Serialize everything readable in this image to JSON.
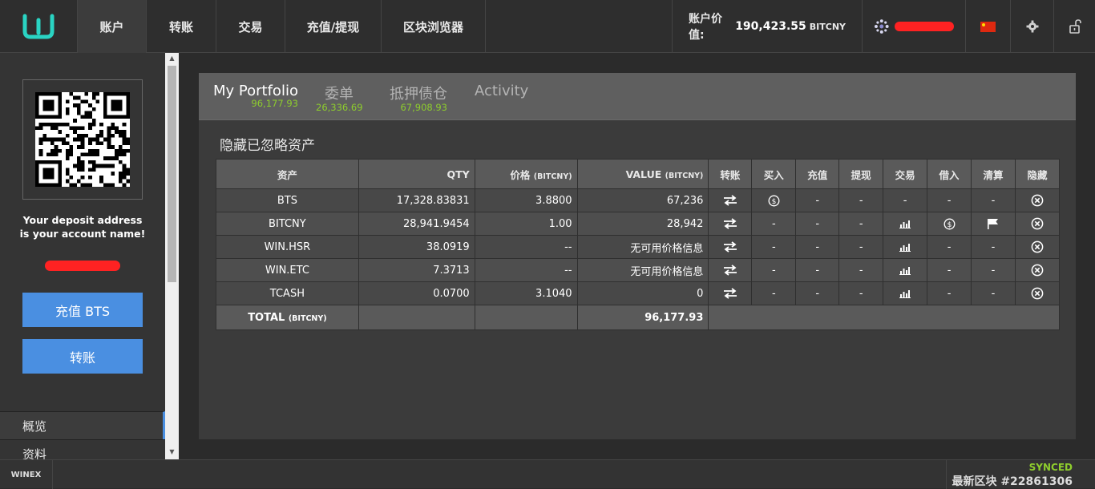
{
  "nav": {
    "items": [
      "账户",
      "转账",
      "交易",
      "充值/提现",
      "区块浏览器"
    ],
    "account_value_label": "账户价值:",
    "account_value": "190,423.55",
    "account_value_unit": "BITCNY"
  },
  "sidebar": {
    "deposit_line1": "Your deposit address",
    "deposit_line2": "is your account name!",
    "deposit_button": "充值 BTS",
    "transfer_button": "转账",
    "menu": [
      "概览",
      "资料"
    ]
  },
  "tabs": [
    {
      "label": "My Portfolio",
      "sub": "96,177.93"
    },
    {
      "label": "委单",
      "sub": "26,336.69"
    },
    {
      "label": "抵押债仓",
      "sub": "67,908.93"
    },
    {
      "label": "Activity",
      "sub": ""
    }
  ],
  "portfolio": {
    "hide_ignored": "隐藏已忽略资产",
    "headers": {
      "asset": "资产",
      "qty": "QTY",
      "price": "价格",
      "price_unit": "(BITCNY)",
      "value": "VALUE",
      "value_unit": "(BITCNY)",
      "transfer": "转账",
      "buy": "买入",
      "deposit": "充值",
      "withdraw": "提现",
      "trade": "交易",
      "borrow": "借入",
      "settle": "清算",
      "hide": "隐藏"
    },
    "rows": [
      {
        "asset": "BTS",
        "qty": "17,328.83831",
        "price": "3.8800",
        "value": "67,236",
        "buy": "icon",
        "deposit": "-",
        "withdraw": "-",
        "trade": "-",
        "borrow": "-",
        "settle": "-"
      },
      {
        "asset": "BITCNY",
        "qty": "28,941.9454",
        "price": "1.00",
        "value": "28,942",
        "buy": "-",
        "deposit": "-",
        "withdraw": "-",
        "trade": "icon",
        "borrow": "icon",
        "settle": "icon"
      },
      {
        "asset": "WIN.HSR",
        "qty": "38.0919",
        "price": "--",
        "value": "无可用价格信息",
        "buy": "-",
        "deposit": "-",
        "withdraw": "-",
        "trade": "icon",
        "borrow": "-",
        "settle": "-"
      },
      {
        "asset": "WIN.ETC",
        "qty": "7.3713",
        "price": "--",
        "value": "无可用价格信息",
        "buy": "-",
        "deposit": "-",
        "withdraw": "-",
        "trade": "icon",
        "borrow": "-",
        "settle": "-"
      },
      {
        "asset": "TCASH",
        "qty": "0.0700",
        "price": "3.1040",
        "value": "0",
        "buy": "-",
        "deposit": "-",
        "withdraw": "-",
        "trade": "icon",
        "borrow": "-",
        "settle": "-"
      }
    ],
    "total_label": "TOTAL",
    "total_unit": "(BITCNY)",
    "total_value": "96,177.93"
  },
  "footer": {
    "brand": "WINEX",
    "synced": "SYNCED",
    "latest_block_label": "最新区块",
    "latest_block": "#22861306"
  },
  "colors": {
    "accent_blue": "#4a8fe1",
    "accent_green": "#8ecd2d",
    "logo_teal": "#2ad4c3",
    "redaction": "#ff2222"
  }
}
